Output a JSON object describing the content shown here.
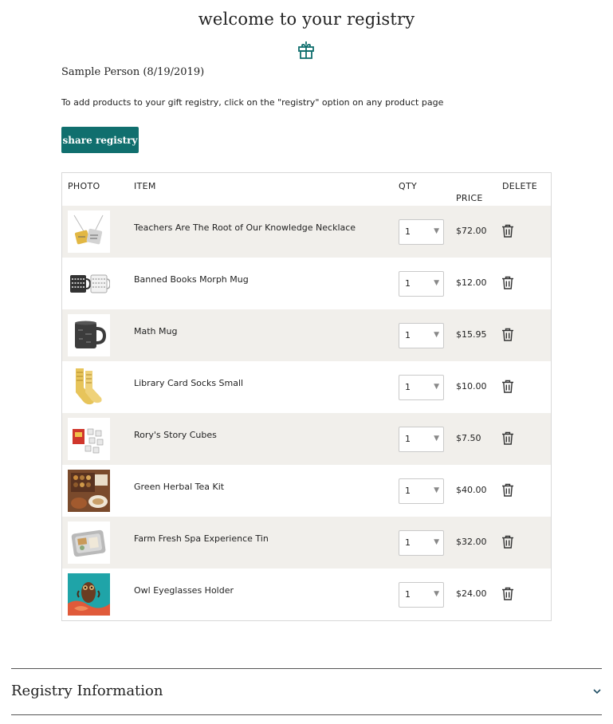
{
  "header": {
    "title": "welcome to your registry",
    "owner": "Sample Person (8/19/2019)",
    "instructions": "To add products to your gift registry, click on the \"registry\" option on any product page",
    "share_label": "share registry"
  },
  "colors": {
    "accent": "#106f6e",
    "row_alt": "#f1efeb"
  },
  "table": {
    "headers": {
      "photo": "PHOTO",
      "item": "ITEM",
      "qty": "QTY",
      "price": "PRICE",
      "delete": "DELETE"
    },
    "rows": [
      {
        "name": "Teachers Are The Root of Our Knowledge Necklace",
        "qty": "1",
        "price": "$72.00"
      },
      {
        "name": "Banned Books Morph Mug",
        "qty": "1",
        "price": "$12.00"
      },
      {
        "name": "Math Mug",
        "qty": "1",
        "price": "$15.95"
      },
      {
        "name": "Library Card Socks Small",
        "qty": "1",
        "price": "$10.00"
      },
      {
        "name": "Rory's Story Cubes",
        "qty": "1",
        "price": "$7.50"
      },
      {
        "name": "Green Herbal Tea Kit",
        "qty": "1",
        "price": "$40.00"
      },
      {
        "name": "Farm Fresh Spa Experience Tin",
        "qty": "1",
        "price": "$32.00"
      },
      {
        "name": "Owl Eyeglasses Holder",
        "qty": "1",
        "price": "$24.00"
      }
    ]
  },
  "accordion": {
    "title": "Registry Information"
  },
  "icons": {
    "header": "gift-icon",
    "delete": "trash-icon",
    "accordion": "chevron-down-icon",
    "select": "caret-down-icon"
  }
}
